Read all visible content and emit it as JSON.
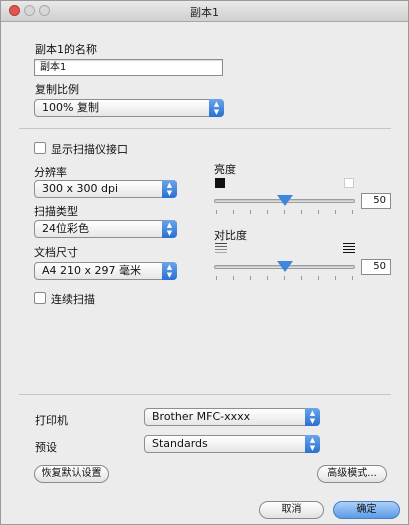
{
  "window": {
    "title": "副本1"
  },
  "profile": {
    "name_label": "副本1的名称",
    "name_value": "副本1",
    "ratio_label": "复制比例",
    "ratio_value": "100% 复制"
  },
  "scan": {
    "show_scanner_interface_label": "显示扫描仪接口",
    "resolution_label": "分辨率",
    "resolution_value": "300 x 300 dpi",
    "scan_type_label": "扫描类型",
    "scan_type_value": "24位彩色",
    "doc_size_label": "文档尺寸",
    "doc_size_value": "A4 210 x 297 毫米",
    "continuous_scan_label": "连续扫描",
    "brightness_label": "亮度",
    "brightness_value": "50",
    "brightness_level": 50,
    "contrast_label": "对比度",
    "contrast_value": "50",
    "contrast_level": 50
  },
  "output": {
    "printer_label": "打印机",
    "printer_value": "Brother MFC-xxxx",
    "preset_label": "预设",
    "preset_value": "Standards"
  },
  "buttons": {
    "restore_defaults": "恢复默认设置",
    "advanced_mode": "高级模式...",
    "cancel": "取消",
    "ok": "确定"
  },
  "colors": {
    "accent": "#3f86dc",
    "close": "#e3554f",
    "default_button": "#5b9be8"
  }
}
